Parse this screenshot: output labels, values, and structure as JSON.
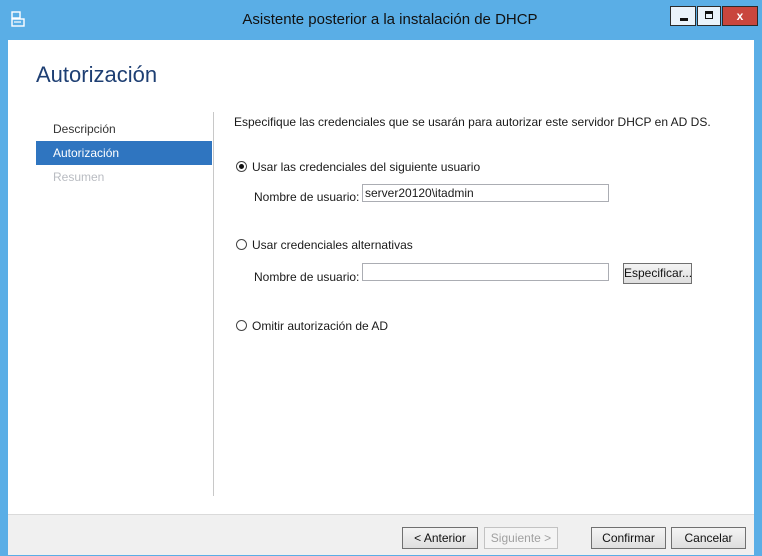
{
  "window": {
    "title": "Asistente posterior a la instalación de DHCP",
    "controls": {
      "minimize": "minimize",
      "maximize": "maximize",
      "close": "x"
    }
  },
  "page": {
    "title": "Autorización"
  },
  "nav": {
    "items": [
      {
        "label": "Descripción",
        "state": "normal"
      },
      {
        "label": "Autorización",
        "state": "selected"
      },
      {
        "label": "Resumen",
        "state": "disabled"
      }
    ]
  },
  "content": {
    "instruction": "Especifique las credenciales que se usarán para autorizar este servidor DHCP en AD DS.",
    "options": [
      {
        "label": "Usar las credenciales del siguiente usuario",
        "checked": true,
        "username_label": "Nombre de usuario:",
        "username_value": "server20120\\itadmin"
      },
      {
        "label": "Usar credenciales alternativas",
        "checked": false,
        "username_label": "Nombre de usuario:",
        "username_value": "",
        "specify_button": "Especificar..."
      },
      {
        "label": "Omitir autorización de AD",
        "checked": false
      }
    ]
  },
  "footer": {
    "back": "< Anterior",
    "next": "Siguiente >",
    "confirm": "Confirmar",
    "cancel": "Cancelar"
  },
  "colors": {
    "titlebar": "#5aaee6",
    "nav_selected": "#2f75c0",
    "page_title": "#1e3f73",
    "close_button": "#c9463d"
  }
}
